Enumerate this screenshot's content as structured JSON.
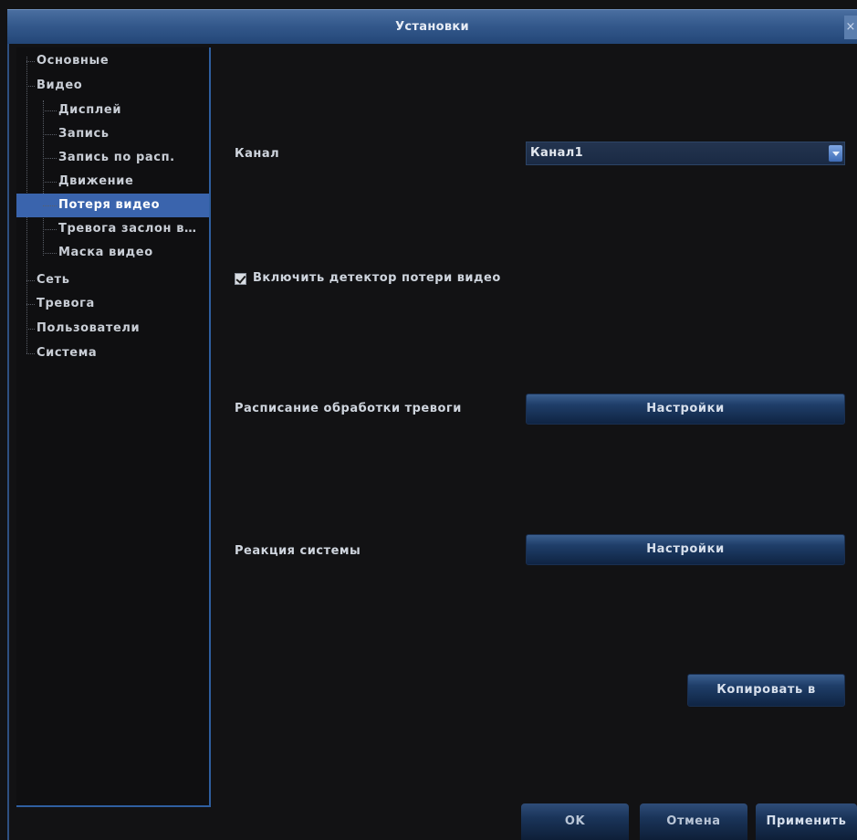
{
  "window": {
    "title": "Установки",
    "close_label": "×"
  },
  "sidebar": {
    "items": [
      {
        "label": "Основные",
        "level": 0,
        "selected": false
      },
      {
        "label": "Видео",
        "level": 0,
        "selected": false
      },
      {
        "label": "Дисплей",
        "level": 1,
        "selected": false
      },
      {
        "label": "Запись",
        "level": 1,
        "selected": false
      },
      {
        "label": "Запись по расп.",
        "level": 1,
        "selected": false
      },
      {
        "label": "Движение",
        "level": 1,
        "selected": false
      },
      {
        "label": "Потеря видео",
        "level": 1,
        "selected": true
      },
      {
        "label": "Тревога заслон в…",
        "level": 1,
        "selected": false
      },
      {
        "label": "Маска видео",
        "level": 1,
        "selected": false
      },
      {
        "label": "Сеть",
        "level": 0,
        "selected": false
      },
      {
        "label": "Тревога",
        "level": 0,
        "selected": false
      },
      {
        "label": "Пользователи",
        "level": 0,
        "selected": false
      },
      {
        "label": "Система",
        "level": 0,
        "selected": false
      }
    ]
  },
  "form": {
    "channel_label": "Канал",
    "channel_value": "Канал1",
    "enable_detector_label": "Включить детектор потери видео",
    "enable_detector_checked": true,
    "schedule_label": "Расписание обработки тревоги",
    "schedule_button": "Настройки",
    "reaction_label": "Реакция системы",
    "reaction_button": "Настройки",
    "copy_button": "Копировать в"
  },
  "footer": {
    "ok": "OK",
    "cancel": "Отмена",
    "apply": "Применить"
  },
  "colors": {
    "accent": "#3a64ad",
    "titlebar": "#34598c",
    "background": "#121214"
  }
}
